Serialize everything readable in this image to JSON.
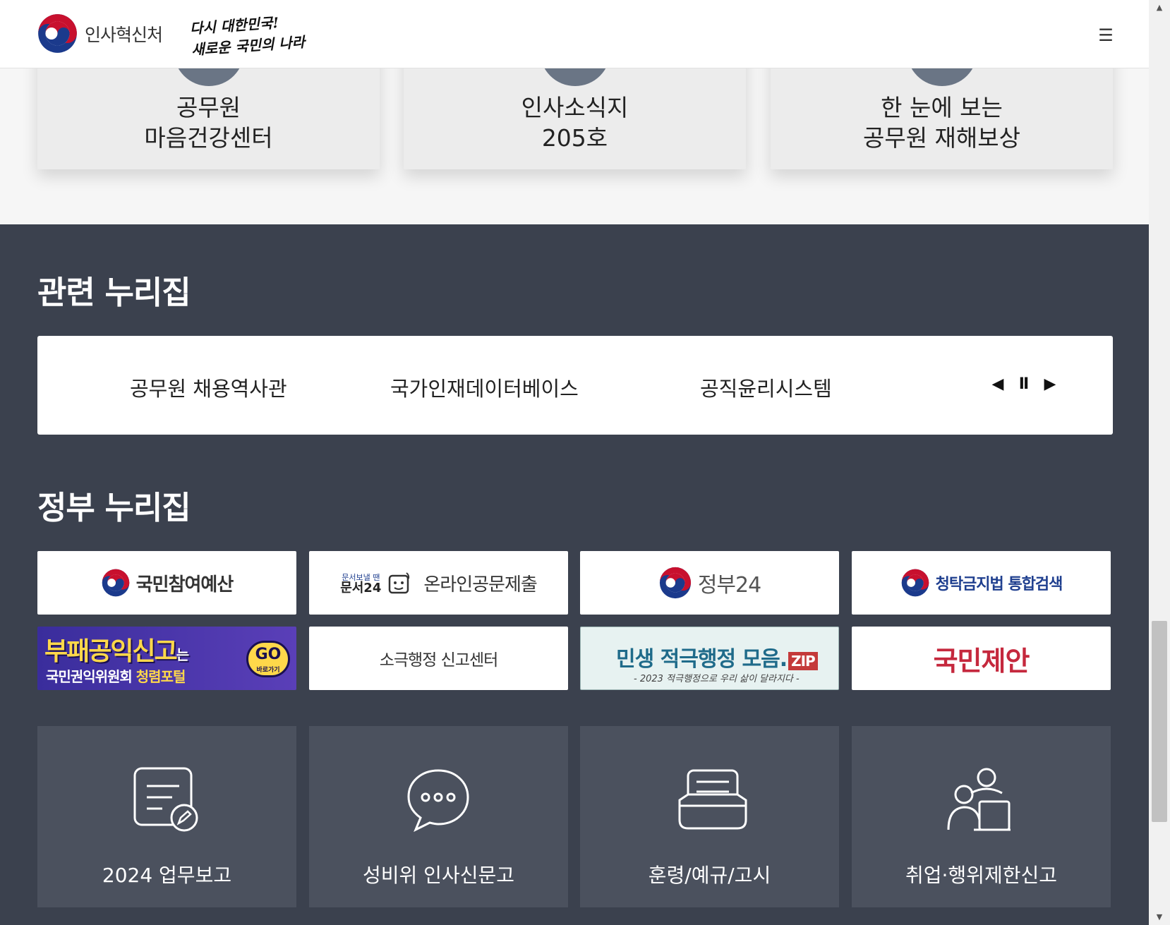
{
  "header": {
    "org_name": "인사혁신처",
    "slogan_line1": "다시 대한민국!",
    "slogan_line2": "새로운 국민의 나라",
    "menu_icon": "☰"
  },
  "top_cards": [
    {
      "title": "공무원\n마음건강센터"
    },
    {
      "title": "인사소식지\n205호"
    },
    {
      "title": "한 눈에 보는\n공무원 재해보상"
    }
  ],
  "related": {
    "title": "관련 누리집",
    "links": [
      "공무원 채용역사관",
      "국가인재데이터베이스",
      "공직윤리시스템"
    ],
    "prev_icon": "◀",
    "pause_icon": "Ⅱ",
    "next_icon": "▶"
  },
  "gov": {
    "title": "정부 누리집",
    "tiles": {
      "budget": "국민참여예산",
      "doc24_small": "문서보낼 땐",
      "doc24_brand": "문서24",
      "doc24": "온라인공문제출",
      "gov24": "정부24",
      "anti_graft": "청탁금지법 통합검색",
      "corrupt_l1": "부패공익신고",
      "corrupt_l1_suffix": "는",
      "corrupt_l2": "국민권익위원회",
      "corrupt_l2_accent": "청렴포털",
      "corrupt_go": "GO",
      "corrupt_go_sub": "바로가기",
      "passive_admin": "소극행정 신고센터",
      "zip_l1": "민생 적극행정 모음.",
      "zip_badge": "ZIP",
      "zip_l2": "- 2023 적극행정으로 우리 삶이 달라지다 -",
      "proposal": "국민제안"
    }
  },
  "quick_links": [
    {
      "label": "2024 업무보고",
      "icon": "report-edit-icon"
    },
    {
      "label": "성비위 인사신문고",
      "icon": "chat-bubble-icon"
    },
    {
      "label": "훈령/예규/고시",
      "icon": "document-tray-icon"
    },
    {
      "label": "취업·행위제한신고",
      "icon": "person-report-icon"
    }
  ],
  "colors": {
    "dark_bg": "#3b414e",
    "tile_bg": "#4b515e",
    "card_bg": "#ececec",
    "accent_red": "#c5283d"
  }
}
